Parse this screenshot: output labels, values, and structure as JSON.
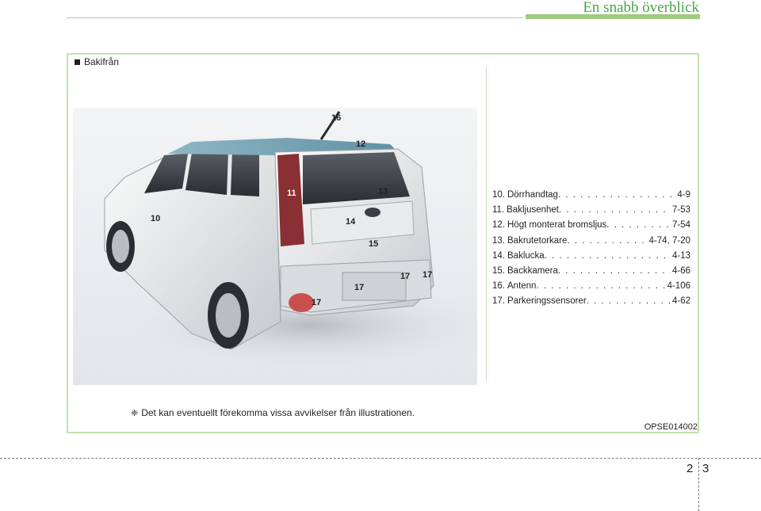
{
  "header": {
    "title": "En snabb överblick"
  },
  "section": {
    "title": "Bakifrån"
  },
  "illustration": {
    "callouts": [
      {
        "label": "16"
      },
      {
        "label": "12"
      },
      {
        "label": "11"
      },
      {
        "label": "13"
      },
      {
        "label": "10"
      },
      {
        "label": "14"
      },
      {
        "label": "15"
      },
      {
        "label": "17"
      },
      {
        "label": "17"
      },
      {
        "label": "17"
      },
      {
        "label": "17"
      }
    ]
  },
  "legend": [
    {
      "num": "10.",
      "name": "Dörrhandtag",
      "page": "4-9"
    },
    {
      "num": "11.",
      "name": "Bakljusenhet",
      "page": "7-53"
    },
    {
      "num": "12.",
      "name": "Högt monterat bromsljus",
      "page": "7-54"
    },
    {
      "num": "13.",
      "name": "Bakrutetorkare",
      "page": "4-74, 7-20"
    },
    {
      "num": "14.",
      "name": "Baklucka",
      "page": "4-13"
    },
    {
      "num": "15.",
      "name": "Backkamera",
      "page": "4-66"
    },
    {
      "num": "16.",
      "name": "Antenn",
      "page": "4-106"
    },
    {
      "num": "17.",
      "name": "Parkeringssensorer",
      "page": "4-62"
    }
  ],
  "note": {
    "icon": "asterisk-icon",
    "text": "Det kan eventuellt förekomma vissa avvikelser från illustrationen."
  },
  "image_code": "OPSE014002",
  "footer": {
    "chapter": "2",
    "page": "3"
  }
}
